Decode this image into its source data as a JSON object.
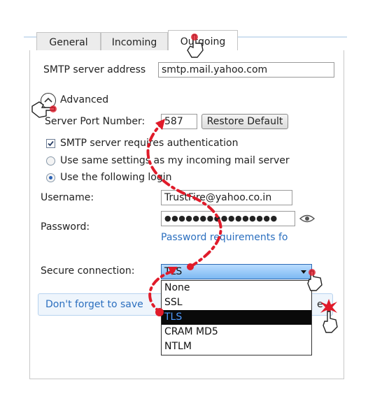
{
  "tabs": [
    {
      "label": "General"
    },
    {
      "label": "Incoming"
    },
    {
      "label": "Outgoing"
    }
  ],
  "smtp": {
    "label": "SMTP server address",
    "value": "smtp.mail.yahoo.com"
  },
  "advanced": {
    "label": "Advanced"
  },
  "port": {
    "label": "Server Port Number:",
    "value": "587",
    "restore_label": "Restore Default"
  },
  "auth": {
    "label": "SMTP server requires authentication"
  },
  "radio_same": {
    "label": "Use same settings as my incoming mail server"
  },
  "radio_login": {
    "label": "Use the following login"
  },
  "username": {
    "label": "Username:",
    "value": "TrustFire@yahoo.co.in"
  },
  "password": {
    "label": "Password:",
    "value": "●●●●●●●●●●●●●●●●",
    "requirements": "Password requirements fo"
  },
  "secure": {
    "label": "Secure connection:",
    "selected": "TLS"
  },
  "secure_options": [
    "None",
    "SSL",
    "TLS",
    "CRAM MD5",
    "NTLM"
  ],
  "notice": {
    "text": "Don't forget to save",
    "button_tail": "e"
  },
  "colors": {
    "annotation": "#e01b2a",
    "link": "#2b6fbf",
    "accent": "#7db9f2"
  }
}
